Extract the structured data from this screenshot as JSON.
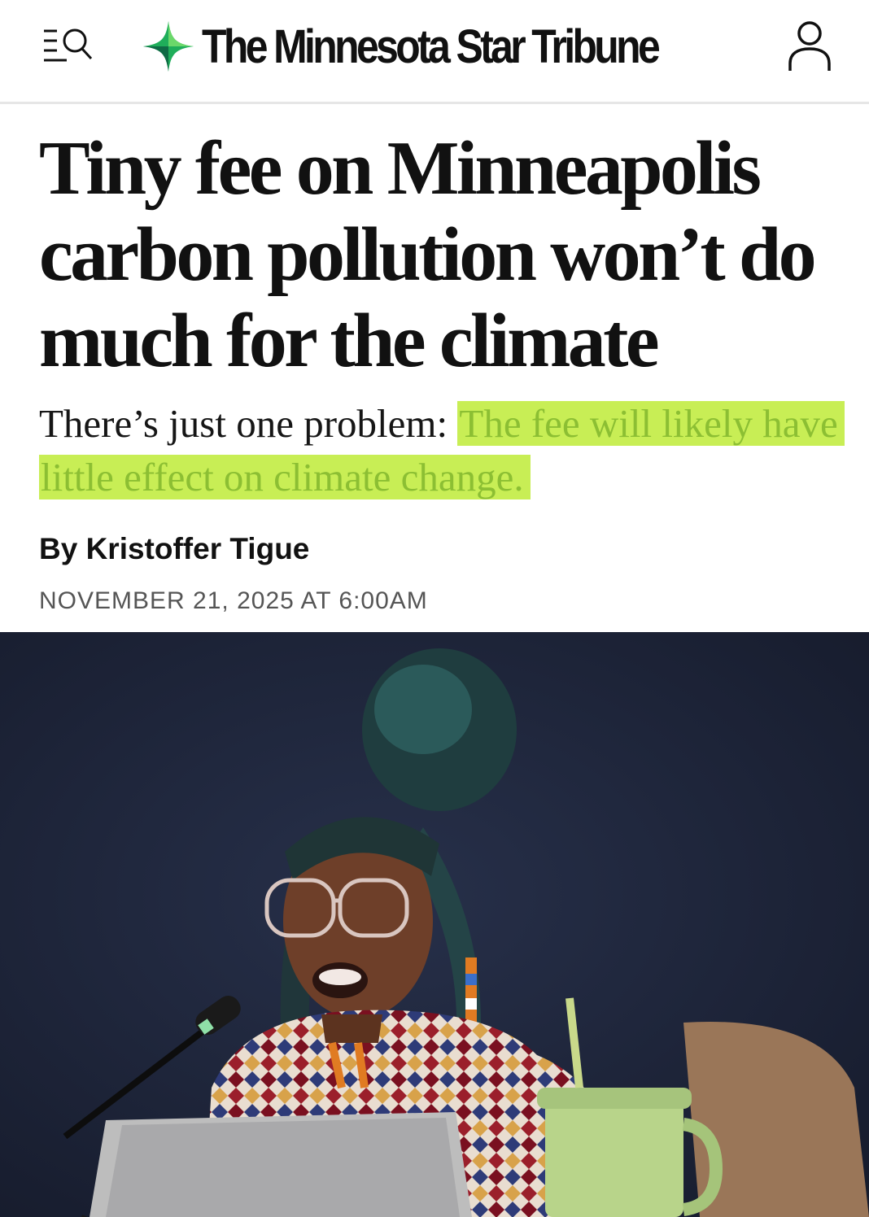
{
  "header": {
    "brand": "The Minnesota Star Tribune",
    "menu_search_icon": "menu-search-icon",
    "account_icon": "user-account-icon",
    "brand_star_colors": [
      "#1fae5a",
      "#6bd86a",
      "#0f6b45"
    ]
  },
  "article": {
    "headline": "Tiny fee on Minneapolis carbon pollution won’t do much for the climate",
    "subhead_plain": "There’s just one problem: ",
    "subhead_highlight": "The fee will likely have little effect on climate change.",
    "byline_prefix": "By ",
    "author": "Kristoffer Tigue",
    "date": "NOVEMBER 21, 2025 AT 6:00AM",
    "highlight_color": "#c8ee55"
  },
  "photo": {
    "description_icon": "article-photo",
    "background_color": "#1c2236"
  }
}
